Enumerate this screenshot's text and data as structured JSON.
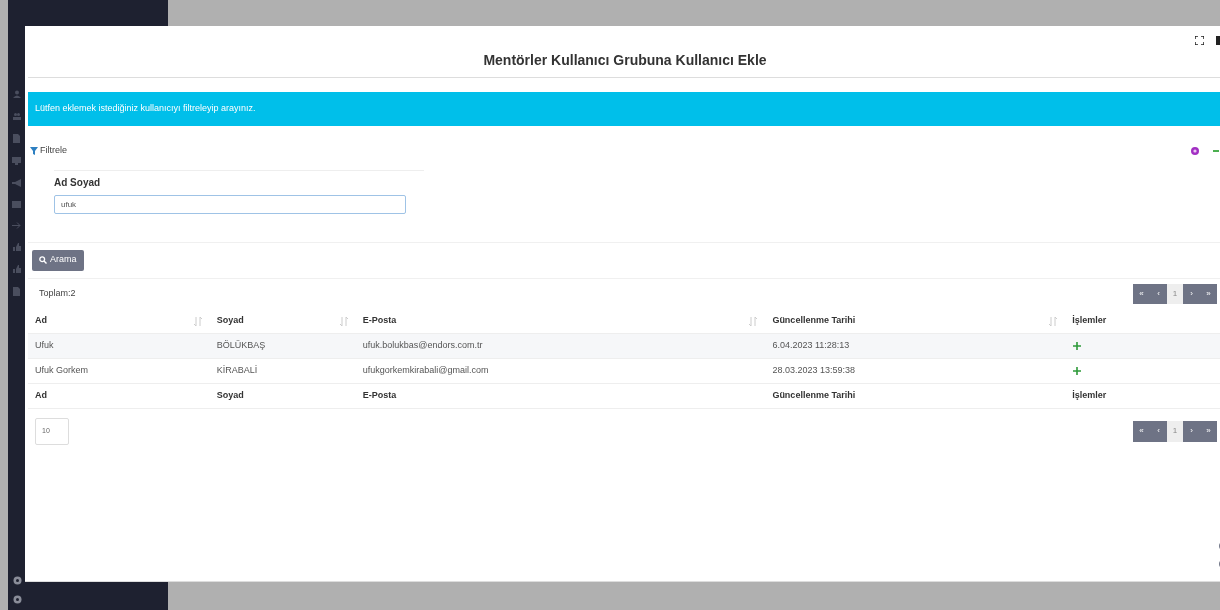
{
  "modal": {
    "title": "Mentörler Kullanıcı Grubuna Kullanıcı Ekle"
  },
  "alert": {
    "text": "Lütfen eklemek istediğiniz kullanıcıyı filtreleyip arayınız."
  },
  "filter": {
    "title": "Filtrele",
    "field_label": "Ad Soyad",
    "value": "ufuk"
  },
  "search_button": "Arama",
  "total": "Toplam:2",
  "pagination_top": [
    {
      "label": "«",
      "selected": false
    },
    {
      "label": "‹",
      "selected": false
    },
    {
      "label": "1",
      "selected": true
    },
    {
      "label": "›",
      "selected": false
    },
    {
      "label": "»",
      "selected": false
    }
  ],
  "table": {
    "columns": [
      "Ad",
      "Soyad",
      "E-Posta",
      "Güncellenme Tarihi",
      "İşlemler"
    ],
    "rows": [
      {
        "cells": [
          "Ufuk",
          "BÖLÜKBAŞ",
          "ufuk.bolukbas@endors.com.tr",
          "6.04.2023 11:28:13"
        ]
      },
      {
        "cells": [
          "Ufuk Gorkem",
          "KİRABALİ",
          "ufukgorkemkirabali@gmail.com",
          "28.03.2023 13:59:38"
        ]
      }
    ],
    "footer": [
      "Ad",
      "Soyad",
      "E-Posta",
      "Güncellenme Tarihi",
      "İşlemler"
    ]
  },
  "page_size": "10",
  "pagination_bottom": [
    {
      "label": "«",
      "selected": false
    },
    {
      "label": "‹",
      "selected": false
    },
    {
      "label": "1",
      "selected": true
    },
    {
      "label": "›",
      "selected": false
    },
    {
      "label": "»",
      "selected": false
    }
  ]
}
